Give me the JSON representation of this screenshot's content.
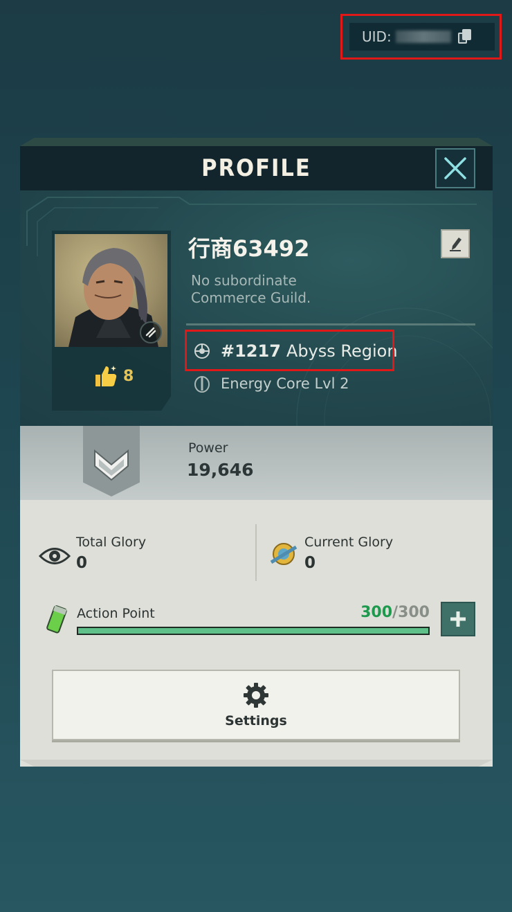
{
  "uid": {
    "label": "UID:",
    "masked_value": "",
    "copy_icon": "copy-icon"
  },
  "header": {
    "title": "PROFILE",
    "close_icon": "close-icon"
  },
  "player": {
    "name": "行商63492",
    "guild_line1": "No subordinate",
    "guild_line2": "Commerce Guild.",
    "likes": "8",
    "region_number": "#1217",
    "region_name": "Abyss Region",
    "energy_core": "Energy Core Lvl 2"
  },
  "power": {
    "label": "Power",
    "value": "19,646"
  },
  "glory": {
    "total_label": "Total Glory",
    "total_value": "0",
    "current_label": "Current Glory",
    "current_value": "0"
  },
  "action_point": {
    "label": "Action Point",
    "current": "300",
    "separator": "/",
    "max": "300",
    "fill_fraction": 1.0
  },
  "settings": {
    "label": "Settings",
    "icon": "gear-icon"
  },
  "colors": {
    "accent_green": "#1d9a4e",
    "highlight_red": "#e01818",
    "header_bg": "#13252c"
  }
}
